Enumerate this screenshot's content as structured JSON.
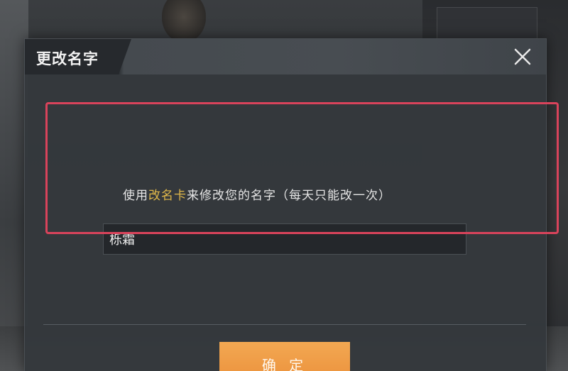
{
  "dialog": {
    "title": "更改名字",
    "close_icon": "close-icon",
    "instruction_prefix": "使用",
    "instruction_item": "改名卡",
    "instruction_suffix": "来修改您的名字（每天只能改一次）",
    "name_value": "栎霜",
    "confirm_label": "确 定"
  },
  "colors": {
    "accent_orange": "#ea8f3a",
    "highlight_text": "#e0b84a",
    "annotation_red": "#d9435b",
    "dialog_bg": "#34383c"
  }
}
